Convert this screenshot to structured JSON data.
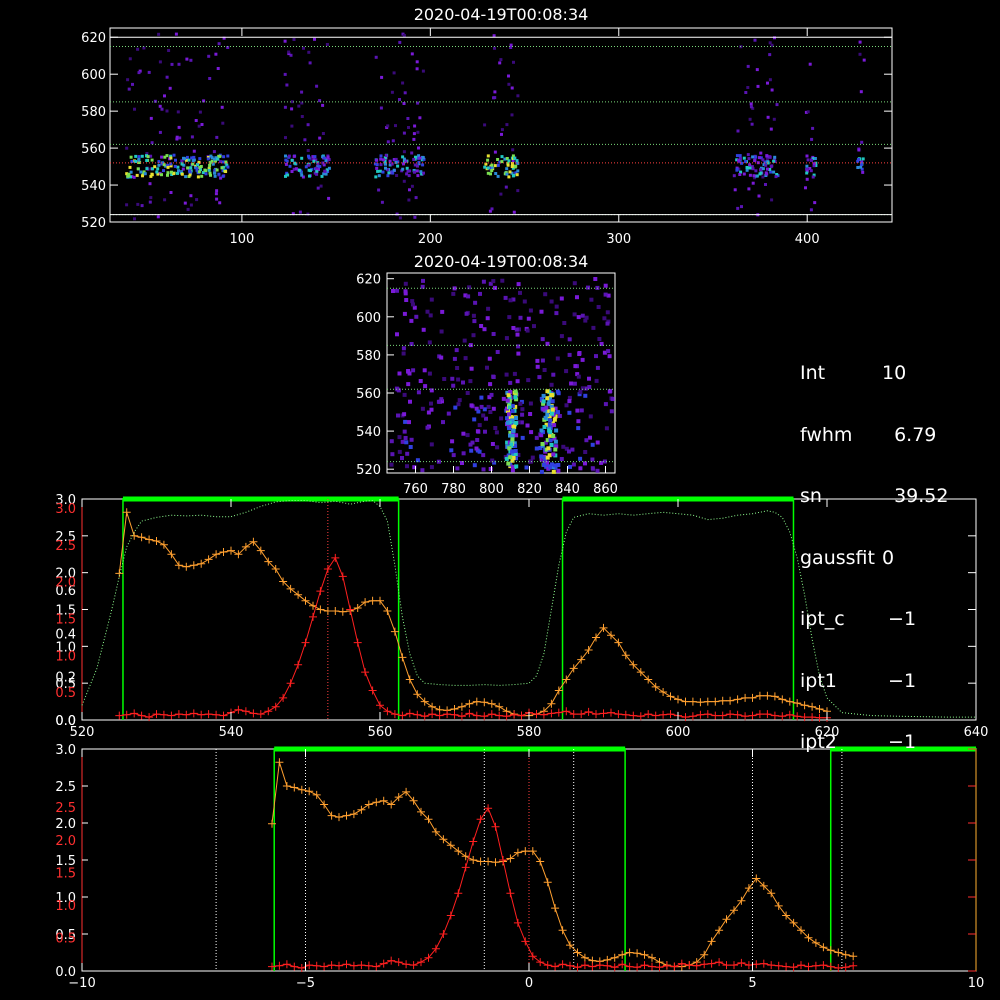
{
  "colors": {
    "orange": "#ffa030",
    "red": "#ff2020",
    "green": "#00ff00",
    "lightgreen": "#90ff90",
    "white": "#ffffff",
    "axis_red": "#ff3030"
  },
  "chart_data": [
    {
      "type": "heatmap",
      "title": "2020-04-19T00:08:34",
      "xlim": [
        30,
        445
      ],
      "ylim": [
        520,
        625
      ],
      "xticks": [
        "100",
        "200",
        "300",
        "400"
      ],
      "xtick_values": [
        100,
        200,
        300,
        400
      ],
      "yticks": [
        "520",
        "540",
        "560",
        "580",
        "600",
        "620"
      ],
      "ytick_values": [
        520,
        540,
        560,
        580,
        600,
        620
      ],
      "hlines_green": [
        615,
        585,
        562,
        524
      ],
      "hlines_red": [
        552
      ],
      "bright_band_y": [
        545,
        557
      ],
      "column_groups_x": [
        [
          38,
          92
        ],
        [
          122,
          146
        ],
        [
          170,
          196
        ],
        [
          228,
          246
        ],
        [
          360,
          384
        ],
        [
          398,
          404
        ],
        [
          426,
          430
        ]
      ]
    },
    {
      "type": "heatmap",
      "title": "2020-04-19T00:08:34",
      "xlim": [
        745,
        865
      ],
      "ylim": [
        518,
        623
      ],
      "xticks": [
        "760",
        "780",
        "800",
        "820",
        "840",
        "860"
      ],
      "xtick_values": [
        760,
        780,
        800,
        820,
        840,
        860
      ],
      "yticks": [
        "520",
        "540",
        "560",
        "580",
        "600",
        "620"
      ],
      "ytick_values": [
        520,
        540,
        560,
        580,
        600,
        620
      ],
      "hlines_green": [
        615,
        585,
        562,
        524
      ],
      "bright_columns_x": [
        [
          807,
          812
        ],
        [
          825,
          833
        ]
      ]
    },
    {
      "type": "line",
      "xlim": [
        520,
        640
      ],
      "xticks": [
        "520",
        "540",
        "560",
        "580",
        "600",
        "620",
        "640"
      ],
      "xtick_values": [
        520,
        540,
        560,
        580,
        600,
        620,
        640
      ],
      "left_axis_labels_white": [
        "0.0",
        "0.5",
        "1.0",
        "1.5",
        "2.0",
        "2.5",
        "3.0"
      ],
      "left_axis_labels_red": [
        "0.0",
        "0.2",
        "0.4",
        "0.6"
      ],
      "left_axis_labels_red_values": [
        0,
        0.2,
        0.4,
        0.6
      ],
      "left_axis_labels_red2": [
        "0.5",
        "1.0",
        "1.5",
        "2.0",
        "2.5",
        "3.0"
      ],
      "ylim": [
        0,
        3.0
      ],
      "green_boxes_x": [
        [
          525.5,
          562.5
        ],
        [
          584.5,
          615.5
        ]
      ],
      "red_vline_x": 553,
      "series": [
        {
          "color": "orange",
          "x": [
            525,
            526,
            527,
            528,
            529,
            530,
            531,
            532,
            533,
            534,
            535,
            536,
            537,
            538,
            539,
            540,
            541,
            542,
            543,
            544,
            545,
            546,
            547,
            548,
            549,
            550,
            551,
            552,
            553,
            554,
            555,
            556,
            557,
            558,
            559,
            560,
            561,
            562,
            563,
            564,
            565,
            566,
            567,
            568,
            569,
            570,
            571,
            572,
            573,
            574,
            575,
            576,
            577,
            578,
            579,
            580,
            581,
            582,
            583,
            584,
            585,
            586,
            587,
            588,
            589,
            590,
            591,
            592,
            593,
            594,
            595,
            596,
            597,
            598,
            599,
            600,
            601,
            602,
            603,
            604,
            605,
            606,
            607,
            608,
            609,
            610,
            611,
            612,
            613,
            614,
            615,
            616,
            617,
            618,
            619,
            620
          ],
          "y": [
            1.99,
            2.82,
            2.5,
            2.48,
            2.45,
            2.43,
            2.38,
            2.25,
            2.1,
            2.08,
            2.1,
            2.12,
            2.18,
            2.25,
            2.28,
            2.3,
            2.25,
            2.35,
            2.42,
            2.3,
            2.15,
            2.05,
            1.88,
            1.78,
            1.7,
            1.62,
            1.55,
            1.5,
            1.48,
            1.48,
            1.47,
            1.48,
            1.52,
            1.6,
            1.62,
            1.62,
            1.48,
            1.2,
            0.85,
            0.55,
            0.35,
            0.25,
            0.18,
            0.14,
            0.13,
            0.15,
            0.18,
            0.22,
            0.25,
            0.24,
            0.22,
            0.18,
            0.12,
            0.08,
            0.06,
            0.06,
            0.08,
            0.12,
            0.22,
            0.4,
            0.55,
            0.7,
            0.82,
            0.95,
            1.12,
            1.25,
            1.15,
            1.05,
            0.88,
            0.75,
            0.65,
            0.55,
            0.45,
            0.38,
            0.32,
            0.28,
            0.25,
            0.25,
            0.24,
            0.25,
            0.25,
            0.26,
            0.26,
            0.28,
            0.3,
            0.3,
            0.33,
            0.33,
            0.32,
            0.28,
            0.25,
            0.23,
            0.2,
            0.18,
            0.15,
            0.12
          ]
        },
        {
          "color": "red",
          "x": [
            525,
            526,
            527,
            528,
            529,
            530,
            531,
            532,
            533,
            534,
            535,
            536,
            537,
            538,
            539,
            540,
            541,
            542,
            543,
            544,
            545,
            546,
            547,
            548,
            549,
            550,
            551,
            552,
            553,
            554,
            555,
            556,
            557,
            558,
            559,
            560,
            561,
            562,
            563,
            564,
            565,
            566,
            567,
            568,
            569,
            570,
            571,
            572,
            573,
            574,
            575,
            576,
            577,
            578,
            579,
            580,
            581,
            582,
            583,
            584,
            585,
            586,
            587,
            588,
            589,
            590,
            591,
            592,
            593,
            594,
            595,
            596,
            597,
            598,
            599,
            600,
            601,
            602,
            603,
            604,
            605,
            606,
            607,
            608,
            609,
            610,
            611,
            612,
            613,
            614,
            615,
            616,
            617,
            618,
            619,
            620
          ],
          "y": [
            0.06,
            0.07,
            0.09,
            0.06,
            0.04,
            0.08,
            0.07,
            0.06,
            0.08,
            0.07,
            0.09,
            0.07,
            0.08,
            0.07,
            0.06,
            0.1,
            0.14,
            0.12,
            0.09,
            0.08,
            0.12,
            0.18,
            0.3,
            0.5,
            0.75,
            1.05,
            1.4,
            1.75,
            2.05,
            2.2,
            1.95,
            1.5,
            1.05,
            0.65,
            0.4,
            0.2,
            0.12,
            0.08,
            0.06,
            0.09,
            0.07,
            0.05,
            0.08,
            0.06,
            0.08,
            0.07,
            0.05,
            0.09,
            0.06,
            0.05,
            0.08,
            0.06,
            0.05,
            0.07,
            0.06,
            0.1,
            0.08,
            0.07,
            0.09,
            0.1,
            0.12,
            0.08,
            0.08,
            0.11,
            0.08,
            0.09,
            0.1,
            0.08,
            0.07,
            0.06,
            0.05,
            0.08,
            0.06,
            0.07,
            0.08,
            0.06,
            0.04,
            0.05,
            0.07,
            0.08,
            0.06,
            0.06,
            0.08,
            0.07,
            0.05,
            0.06,
            0.08,
            0.08,
            0.06,
            0.05,
            0.07,
            0.05,
            0.04,
            0.04,
            0.03,
            0.03
          ]
        },
        {
          "color": "lightgreen",
          "dotted": true,
          "x": [
            520,
            522,
            524,
            525,
            526,
            527,
            528,
            530,
            532,
            534,
            536,
            538,
            540,
            542,
            544,
            546,
            548,
            550,
            552,
            554,
            556,
            558,
            559,
            560,
            561,
            562,
            563,
            564,
            565,
            566,
            568,
            570,
            572,
            574,
            576,
            578,
            580,
            581,
            582,
            583,
            584,
            585,
            586,
            588,
            590,
            592,
            594,
            596,
            598,
            600,
            602,
            604,
            606,
            608,
            610,
            612,
            613,
            614,
            615,
            616,
            617,
            618,
            619,
            620,
            622,
            626,
            630,
            636,
            640
          ],
          "y": [
            0.2,
            0.7,
            1.5,
            1.95,
            2.35,
            2.55,
            2.7,
            2.75,
            2.78,
            2.77,
            2.78,
            2.76,
            2.76,
            2.82,
            2.9,
            2.96,
            2.98,
            2.98,
            2.95,
            2.97,
            2.93,
            2.97,
            2.98,
            2.9,
            2.7,
            2.1,
            1.4,
            0.9,
            0.6,
            0.5,
            0.48,
            0.47,
            0.47,
            0.48,
            0.47,
            0.48,
            0.5,
            0.6,
            0.9,
            1.5,
            2.1,
            2.55,
            2.75,
            2.8,
            2.78,
            2.8,
            2.78,
            2.8,
            2.82,
            2.8,
            2.78,
            2.72,
            2.74,
            2.78,
            2.8,
            2.84,
            2.82,
            2.75,
            2.55,
            2.2,
            1.7,
            1.1,
            0.6,
            0.3,
            0.1,
            0.06,
            0.05,
            0.04,
            0.04
          ]
        }
      ]
    },
    {
      "type": "line",
      "xlim": [
        -10,
        10
      ],
      "xticks": [
        "−10",
        "−5",
        "0",
        "5",
        "10"
      ],
      "xtick_values": [
        -10,
        -5,
        0,
        5,
        10
      ],
      "left_axis_labels_white": [
        "0.0",
        "0.5",
        "1.0",
        "1.5",
        "2.0",
        "2.5",
        "3.0"
      ],
      "left_axis_labels_red": [
        "0.0",
        "0.5",
        "1.0",
        "1.5",
        "2.0",
        "2.5",
        "3.0"
      ],
      "ylim": [
        0,
        3.0
      ],
      "green_boxes_x": [
        [
          -5.7,
          2.15
        ],
        [
          6.75,
          10
        ]
      ],
      "white_vlines_x": [
        -7,
        -5,
        -1,
        1,
        5,
        7
      ],
      "red_vline_x": 0,
      "series": [
        {
          "color": "orange",
          "x_start": -5.75,
          "x_step": 0.1667,
          "y": [
            1.99,
            2.82,
            2.5,
            2.48,
            2.45,
            2.43,
            2.38,
            2.25,
            2.1,
            2.08,
            2.1,
            2.12,
            2.18,
            2.25,
            2.28,
            2.3,
            2.25,
            2.35,
            2.42,
            2.3,
            2.15,
            2.05,
            1.88,
            1.78,
            1.7,
            1.62,
            1.55,
            1.5,
            1.48,
            1.48,
            1.47,
            1.48,
            1.52,
            1.6,
            1.62,
            1.62,
            1.48,
            1.2,
            0.85,
            0.55,
            0.35,
            0.25,
            0.18,
            0.14,
            0.13,
            0.15,
            0.18,
            0.22,
            0.25,
            0.24,
            0.22,
            0.18,
            0.12,
            0.08,
            0.06,
            0.06,
            0.08,
            0.12,
            0.22,
            0.4,
            0.55,
            0.7,
            0.82,
            0.95,
            1.12,
            1.25,
            1.15,
            1.05,
            0.88,
            0.75,
            0.65,
            0.55,
            0.45,
            0.38,
            0.32,
            0.28,
            0.25,
            0.22,
            0.2
          ]
        },
        {
          "color": "red",
          "x_start": -5.75,
          "x_step": 0.1667,
          "y": [
            0.06,
            0.07,
            0.09,
            0.06,
            0.04,
            0.08,
            0.07,
            0.06,
            0.08,
            0.07,
            0.09,
            0.07,
            0.08,
            0.07,
            0.06,
            0.1,
            0.14,
            0.12,
            0.09,
            0.08,
            0.12,
            0.18,
            0.3,
            0.5,
            0.75,
            1.05,
            1.4,
            1.75,
            2.05,
            2.2,
            1.95,
            1.5,
            1.05,
            0.65,
            0.4,
            0.2,
            0.12,
            0.08,
            0.06,
            0.09,
            0.07,
            0.05,
            0.08,
            0.06,
            0.08,
            0.07,
            0.05,
            0.09,
            0.06,
            0.05,
            0.08,
            0.06,
            0.05,
            0.07,
            0.06,
            0.1,
            0.08,
            0.07,
            0.09,
            0.1,
            0.12,
            0.08,
            0.08,
            0.11,
            0.08,
            0.09,
            0.1,
            0.08,
            0.07,
            0.06,
            0.05,
            0.08,
            0.06,
            0.07,
            0.08,
            0.06,
            0.04,
            0.05,
            0.07
          ]
        }
      ]
    }
  ],
  "info": [
    {
      "key": "Int",
      "value": "10"
    },
    {
      "key": "fwhm",
      "value": "  6.79"
    },
    {
      "key": "sn",
      "value": "  39.52"
    },
    {
      "key": "gaussfit",
      "value": "0"
    },
    {
      "key": "ipt_c",
      "value": " −1"
    },
    {
      "key": "ipt1",
      "value": " −1"
    },
    {
      "key": "ipt2",
      "value": " −1"
    }
  ]
}
